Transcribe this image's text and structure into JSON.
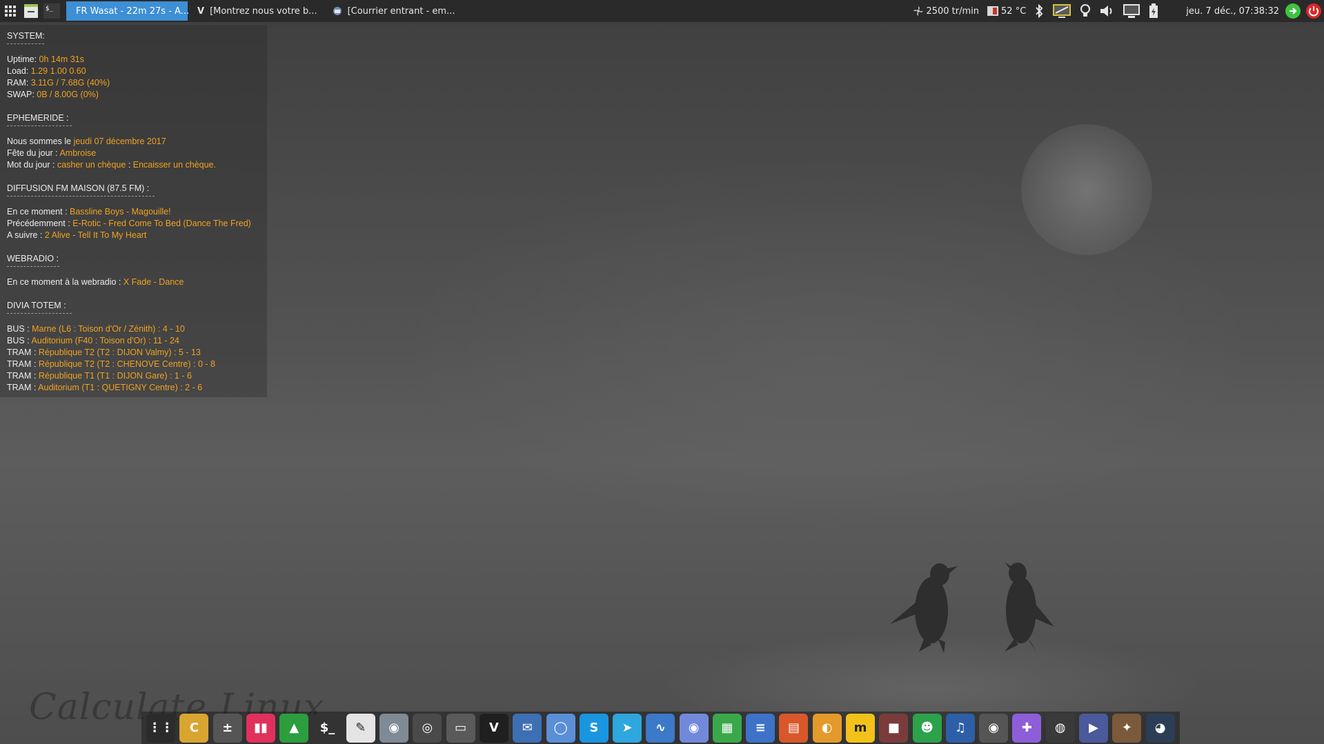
{
  "taskbar": {
    "tasks": [
      {
        "label": "FR Wasat - 22m 27s - A...",
        "active": true
      },
      {
        "label": "[Montrez nous votre b...",
        "active": false
      },
      {
        "label": "[Courrier entrant - em...",
        "active": false
      }
    ],
    "tray": {
      "fan": "2500 tr/min",
      "temp": "52 °C",
      "clock": "jeu.  7 déc., 07:38:32"
    }
  },
  "conky": {
    "system": {
      "title": "SYSTEM:",
      "uptime_label": "Uptime: ",
      "uptime": "0h 14m 31s",
      "load_label": "Load: ",
      "load": "1.29 1.00 0.60",
      "ram_label": "RAM:  ",
      "ram": "3.11G / 7.68G (40%)",
      "swap_label": "SWAP:  ",
      "swap": "0B / 8.00G (0%)"
    },
    "ephemeride": {
      "title": "EPHEMERIDE :",
      "date_label": "Nous sommes le ",
      "date": "jeudi 07 décembre 2017",
      "fete_label": "Fête du jour :  ",
      "fete": "Ambroise",
      "mot_label": "Mot du jour : ",
      "mot": "casher un chèque",
      "mot_sep": " : ",
      "mot_def": "Encaisser un chèque."
    },
    "fm": {
      "title": "DIFFUSION FM MAISON (87.5 FM) :",
      "now_label": "En ce moment :  ",
      "now": "Bassline Boys - Magouille!",
      "prev_label": "Précédemment :  ",
      "prev": "E-Rotic - Fred Come To Bed (Dance The Fred)",
      "next_label": "A suivre : ",
      "next": "2 Alive - Tell It To My Heart"
    },
    "webradio": {
      "title": "WEBRADIO :",
      "now_label": "En ce moment à la webradio : ",
      "now": "X Fade - Dance"
    },
    "divia": {
      "title": "DIVIA TOTEM :",
      "lines": [
        {
          "label": "BUS : ",
          "value": "Marne (L6 : Toison d'Or / Zénith) : 4 - 10"
        },
        {
          "label": "BUS : ",
          "value": "Auditorium (F40 : Toison d'Or) : 11 - 24"
        },
        {
          "label": "TRAM : ",
          "value": "République T2 (T2 : DIJON Valmy) : 5 - 13"
        },
        {
          "label": "TRAM : ",
          "value": "République T2 (T2 : CHENOVE Centre) : 0 - 8"
        },
        {
          "label": "TRAM : ",
          "value": "République T1 (T1 : DIJON Gare) : 1 - 6"
        },
        {
          "label": "TRAM : ",
          "value": "Auditorium (T1 : QUETIGNY Centre) : 2 - 6"
        }
      ]
    }
  },
  "dock": {
    "apps": [
      {
        "name": "app-launcher-icon",
        "bg": "#2b2b2b",
        "glyph": "⋮⋮"
      },
      {
        "name": "calculate-icon",
        "bg": "#d9a531",
        "glyph": "C"
      },
      {
        "name": "calculator-icon",
        "bg": "#555555",
        "glyph": "±"
      },
      {
        "name": "mixer-icon",
        "bg": "#e0315c",
        "glyph": "▮▮"
      },
      {
        "name": "system-monitor-icon",
        "bg": "#2c9e3e",
        "glyph": "▲"
      },
      {
        "name": "terminal-icon",
        "bg": "#333333",
        "glyph": "$_"
      },
      {
        "name": "text-editor-icon",
        "bg": "#e4e4e4",
        "glyph": "✎"
      },
      {
        "name": "screenshot-icon",
        "bg": "#7f8a95",
        "glyph": "◉"
      },
      {
        "name": "speaker-icon",
        "bg": "#4a4a4a",
        "glyph": "◎"
      },
      {
        "name": "file-manager-icon",
        "bg": "#5a5a5a",
        "glyph": "▭"
      },
      {
        "name": "vivaldi-icon",
        "bg": "#1f1f1f",
        "glyph": "V"
      },
      {
        "name": "thunderbird-icon",
        "bg": "#3d6fb3",
        "glyph": "✉"
      },
      {
        "name": "chromium-icon",
        "bg": "#5a8fd8",
        "glyph": "◯"
      },
      {
        "name": "skype-icon",
        "bg": "#1a95e0",
        "glyph": "S"
      },
      {
        "name": "telegram-icon",
        "bg": "#2ea6de",
        "glyph": "➤"
      },
      {
        "name": "audio-wave-icon",
        "bg": "#3c79c9",
        "glyph": "∿"
      },
      {
        "name": "discord-icon",
        "bg": "#7289da",
        "glyph": "◉"
      },
      {
        "name": "spreadsheet-icon",
        "bg": "#3aa84a",
        "glyph": "▦"
      },
      {
        "name": "writer-icon",
        "bg": "#3d72c8",
        "glyph": "≡"
      },
      {
        "name": "impress-icon",
        "bg": "#d9572a",
        "glyph": "▤"
      },
      {
        "name": "croissant-icon",
        "bg": "#e39a2a",
        "glyph": "◐"
      },
      {
        "name": "m-app-icon",
        "bg": "#f2c21a",
        "glyph": "m"
      },
      {
        "name": "video-recorder-icon",
        "bg": "#7a3b3b",
        "glyph": "■"
      },
      {
        "name": "frog-app-icon",
        "bg": "#2ca24a",
        "glyph": "☻"
      },
      {
        "name": "audacity-icon",
        "bg": "#2d5fa8",
        "glyph": "♫"
      },
      {
        "name": "media-player-icon",
        "bg": "#555555",
        "glyph": "◉"
      },
      {
        "name": "gamepad-icon",
        "bg": "#8d5ed8",
        "glyph": "✚"
      },
      {
        "name": "obs-icon",
        "bg": "#3a3a3a",
        "glyph": "◍"
      },
      {
        "name": "dock-tool-icon",
        "bg": "#4a5a9a",
        "glyph": "▶"
      },
      {
        "name": "bird-app-icon",
        "bg": "#7a5a3a",
        "glyph": "✦"
      },
      {
        "name": "steam-icon",
        "bg": "#2b3e55",
        "glyph": "◕"
      }
    ]
  },
  "desktop": {
    "brand": "Calculate Linux"
  }
}
